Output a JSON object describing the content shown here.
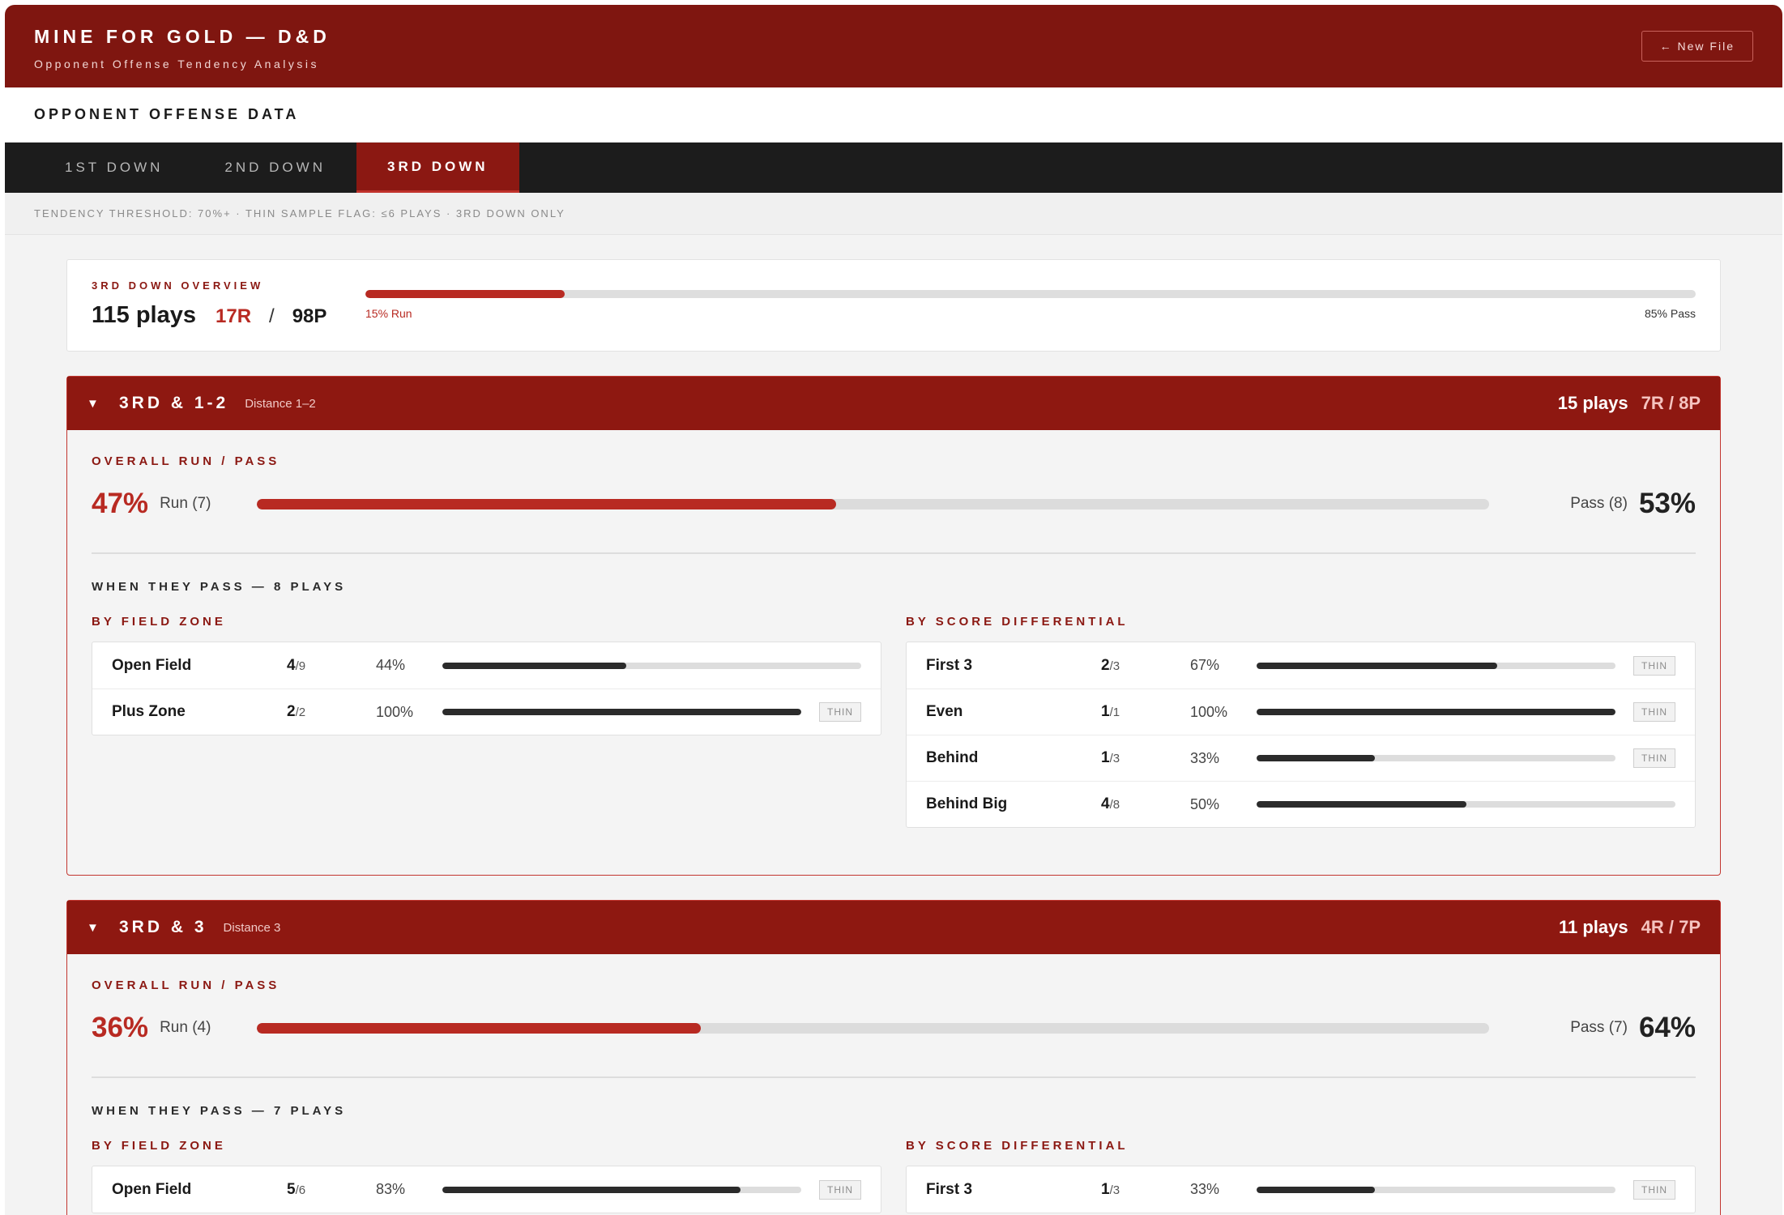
{
  "app": {
    "title": "MINE FOR GOLD — D&D",
    "subtitle": "Opponent Offense Tendency Analysis",
    "new_file_label": "← New File"
  },
  "section_title": "OPPONENT OFFENSE DATA",
  "tabs": [
    {
      "label": "1ST DOWN",
      "active": false
    },
    {
      "label": "2ND DOWN",
      "active": false
    },
    {
      "label": "3RD DOWN",
      "active": true
    }
  ],
  "threshold_text": "TENDENCY THRESHOLD: 70%+ · THIN SAMPLE FLAG: ≤6 PLAYS · 3RD DOWN ONLY",
  "overview": {
    "label": "3RD DOWN OVERVIEW",
    "plays": "115 plays",
    "run": "17R",
    "slash": "/",
    "pass": "98P",
    "run_fraction": 0.15,
    "run_label": "15% Run",
    "pass_label": "85% Pass"
  },
  "situations": [
    {
      "caret": "▼",
      "name": "3RD & 1-2",
      "distance": "Distance 1–2",
      "plays": "15 plays",
      "rp": "7R / 8P",
      "overall_head": "OVERALL RUN / PASS",
      "run_pct": "47%",
      "run_count": "Run (7)",
      "run_fraction": 0.47,
      "pass_count": "Pass (8)",
      "pass_pct": "53%",
      "pass_head": "WHEN THEY PASS — 8 PLAYS",
      "field_head": "BY FIELD ZONE",
      "score_head": "BY SCORE DIFFERENTIAL",
      "field_zone": [
        {
          "name": "Open Field",
          "num": "4",
          "den": "/9",
          "pct": "44%",
          "fraction": 0.44,
          "thin": ""
        },
        {
          "name": "Plus Zone",
          "num": "2",
          "den": "/2",
          "pct": "100%",
          "fraction": 1.0,
          "thin": "THIN"
        }
      ],
      "score_diff": [
        {
          "name": "First 3",
          "num": "2",
          "den": "/3",
          "pct": "67%",
          "fraction": 0.67,
          "thin": "THIN"
        },
        {
          "name": "Even",
          "num": "1",
          "den": "/1",
          "pct": "100%",
          "fraction": 1.0,
          "thin": "THIN"
        },
        {
          "name": "Behind",
          "num": "1",
          "den": "/3",
          "pct": "33%",
          "fraction": 0.33,
          "thin": "THIN"
        },
        {
          "name": "Behind Big",
          "num": "4",
          "den": "/8",
          "pct": "50%",
          "fraction": 0.5,
          "thin": ""
        }
      ]
    },
    {
      "caret": "▼",
      "name": "3RD & 3",
      "distance": "Distance 3",
      "plays": "11 plays",
      "rp": "4R / 7P",
      "overall_head": "OVERALL RUN / PASS",
      "run_pct": "36%",
      "run_count": "Run (4)",
      "run_fraction": 0.36,
      "pass_count": "Pass (7)",
      "pass_pct": "64%",
      "pass_head": "WHEN THEY PASS — 7 PLAYS",
      "field_head": "BY FIELD ZONE",
      "score_head": "BY SCORE DIFFERENTIAL",
      "field_zone": [
        {
          "name": "Open Field",
          "num": "5",
          "den": "/6",
          "pct": "83%",
          "fraction": 0.83,
          "thin": "THIN"
        }
      ],
      "score_diff": [
        {
          "name": "First 3",
          "num": "1",
          "den": "/3",
          "pct": "33%",
          "fraction": 0.33,
          "thin": "THIN"
        }
      ]
    }
  ]
}
